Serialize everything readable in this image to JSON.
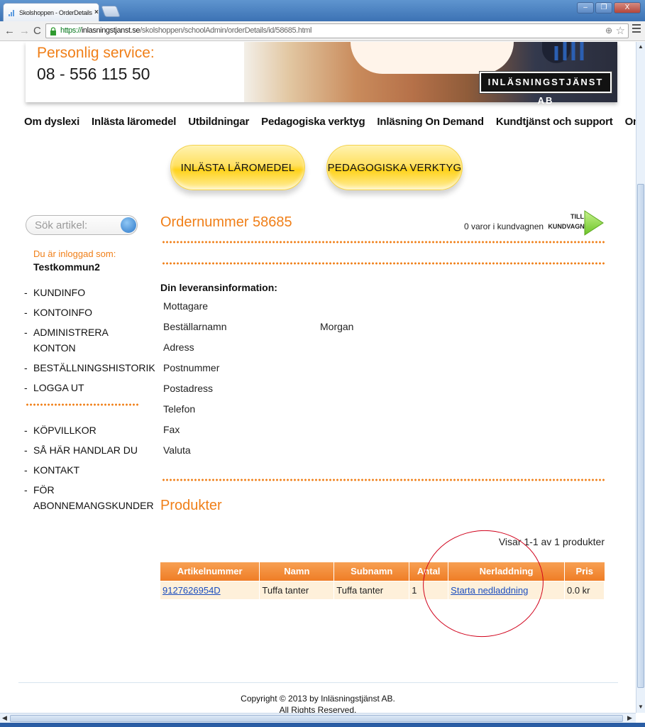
{
  "browser": {
    "tab_title": "Skolshoppen - OrderDetails S",
    "tab_close": "×",
    "url_scheme": "https",
    "url_host": "inlasningstjanst.se",
    "url_path": "/skolshoppen/schoolAdmin/orderDetails/id/58685.html",
    "window_buttons": [
      "–",
      "❐",
      "X"
    ]
  },
  "banner": {
    "service_label": "Personlig service:",
    "phone": "08 - 556 115 50",
    "logo_text": "INLÄSNINGSTJÄNST AB"
  },
  "topnav": [
    "Om dyslexi",
    "Inlästa läromedel",
    "Utbildningar",
    "Pedagogiska verktyg",
    "Inläsning On Demand",
    "Kundtjänst och support",
    "Om oss"
  ],
  "big_buttons": {
    "left": "INLÄSTA LÄROMEDEL",
    "right": "PEDAGOGISKA VERKTYG"
  },
  "sidebar": {
    "search_placeholder": "Sök artikel:",
    "logged_in_label": "Du är inloggad som:",
    "username": "Testkommun2",
    "menu1": [
      "KUNDINFO",
      "KONTOINFO",
      "ADMINISTRERA KONTON",
      "BESTÄLLNINGSHISTORIK",
      "LOGGA UT"
    ],
    "menu2": [
      "KÖPVILLKOR",
      "SÅ HÄR HANDLAR DU",
      "KONTAKT",
      "FÖR ABONNEMANGSKUNDER"
    ]
  },
  "order": {
    "title": "Ordernummer 58685",
    "cart_text": "0 varor i kundvagnen",
    "cart_till": "TILL",
    "cart_link": "KUNDVAGNEN"
  },
  "delivery": {
    "heading": "Din leveransinformation:",
    "rows": [
      {
        "label": "Mottagare",
        "value": ""
      },
      {
        "label": "Beställarnamn",
        "value": "Morgan"
      },
      {
        "label": "Adress",
        "value": ""
      },
      {
        "label": "Postnummer",
        "value": ""
      },
      {
        "label": "Postadress",
        "value": ""
      },
      {
        "label": "Telefon",
        "value": ""
      },
      {
        "label": "Fax",
        "value": ""
      },
      {
        "label": "Valuta",
        "value": ""
      }
    ]
  },
  "products": {
    "title": "Produkter",
    "showing": "Visar 1-1 av 1 produkter",
    "columns": [
      "Artikelnummer",
      "Namn",
      "Subnamn",
      "Antal",
      "Nerladdning",
      "Pris"
    ],
    "rows": [
      [
        "9127626954D",
        "Tuffa tanter",
        "Tuffa tanter",
        "1",
        "Starta nedladdning",
        "0.0 kr"
      ]
    ]
  },
  "footer": {
    "copyright": "Copyright © 2013 by Inläsningstjänst AB.",
    "rights": "All Rights Reserved."
  },
  "colors": {
    "accent_orange": "#f07f18",
    "table_row": "#fef0da",
    "annotation_red": "#d0001a"
  }
}
